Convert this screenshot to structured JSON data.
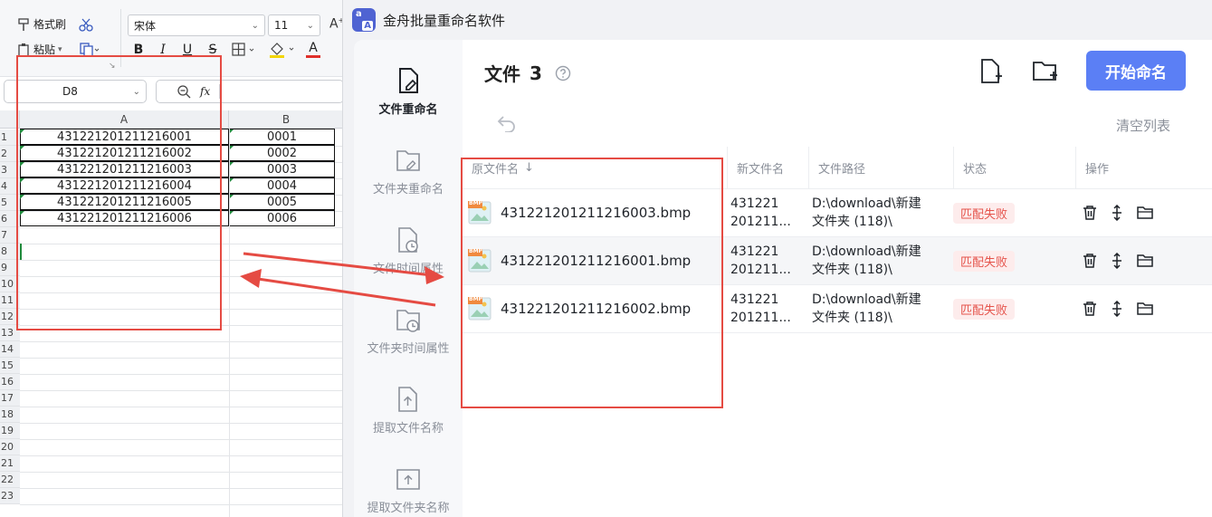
{
  "spreadsheet": {
    "ribbon": {
      "format_painter": "格式刷",
      "paste": "粘贴",
      "font_name": "宋体",
      "font_size": "11",
      "bold": "B",
      "italic": "I",
      "underline": "U",
      "strikethrough": "S",
      "font_color_letter": "A"
    },
    "name_box": "D8",
    "fx_label": "fx",
    "column_headers": [
      "A",
      "B"
    ],
    "row_numbers": [
      "1",
      "2",
      "3",
      "4",
      "5",
      "6",
      "7",
      "8",
      "9",
      "10",
      "11",
      "12",
      "13",
      "14",
      "15",
      "16",
      "17",
      "18",
      "19",
      "20",
      "21",
      "22",
      "23"
    ],
    "rows": [
      {
        "a": "431221201211216001",
        "b": "0001"
      },
      {
        "a": "431221201211216002",
        "b": "0002"
      },
      {
        "a": "431221201211216003",
        "b": "0003"
      },
      {
        "a": "431221201211216004",
        "b": "0004"
      },
      {
        "a": "431221201211216005",
        "b": "0005"
      },
      {
        "a": "431221201211216006",
        "b": "0006"
      }
    ]
  },
  "app": {
    "title": "金舟批量重命名软件",
    "logo_letters": {
      "top": "a",
      "bottom": "A"
    },
    "sidebar": [
      {
        "label": "文件重命名",
        "icon": "file-edit-icon",
        "active": true
      },
      {
        "label": "文件夹重命名",
        "icon": "folder-edit-icon",
        "active": false
      },
      {
        "label": "文件时间属性",
        "icon": "file-clock-icon",
        "active": false
      },
      {
        "label": "文件夹时间属性",
        "icon": "folder-clock-icon",
        "active": false
      },
      {
        "label": "提取文件名称",
        "icon": "file-upload-icon",
        "active": false
      },
      {
        "label": "提取文件夹名称",
        "icon": "folder-upload-icon",
        "active": false
      }
    ],
    "header": {
      "title": "文件",
      "count": "3",
      "help_icon": "question-icon",
      "add_file_icon": "add-file-icon",
      "add_folder_icon": "add-folder-icon",
      "start_button": "开始命名"
    },
    "toolbar": {
      "undo_icon": "undo-icon",
      "clear_list": "清空列表"
    },
    "table": {
      "columns": [
        "原文件名",
        "新文件名",
        "文件路径",
        "状态",
        "操作"
      ],
      "rows": [
        {
          "original": "431221201211216003.bmp",
          "new_line1": "431221",
          "new_line2": "201211...",
          "path_line1": "D:\\download\\新建",
          "path_line2": "文件夹 (118)\\",
          "status": "匹配失败",
          "thumb": "BMP"
        },
        {
          "original": "431221201211216001.bmp",
          "new_line1": "431221",
          "new_line2": "201211...",
          "path_line1": "D:\\download\\新建",
          "path_line2": "文件夹 (118)\\",
          "status": "匹配失败",
          "thumb": "BMP"
        },
        {
          "original": "431221201211216002.bmp",
          "new_line1": "431221",
          "new_line2": "201211...",
          "path_line1": "D:\\download\\新建",
          "path_line2": "文件夹 (118)\\",
          "status": "匹配失败",
          "thumb": "BMP"
        }
      ],
      "action_icons": [
        "trash-icon",
        "move-icon",
        "open-folder-icon"
      ]
    },
    "colors": {
      "accent": "#5b7ff5",
      "fail": "#e5534b",
      "annotation": "#e54b43"
    }
  }
}
